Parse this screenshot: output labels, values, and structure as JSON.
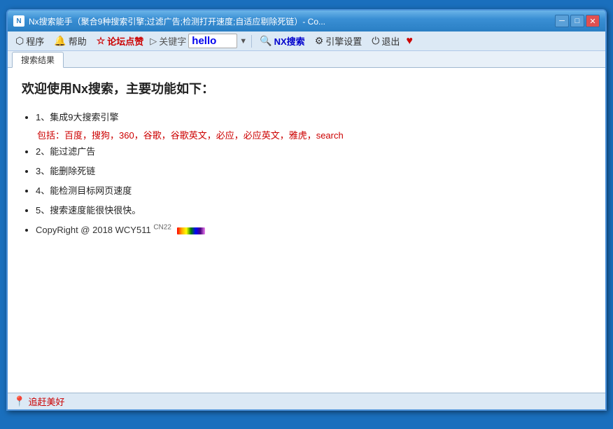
{
  "window": {
    "title": "Nx搜索能手（聚合9种搜索引擎;过滤广告;检测打开速度;自适应剔除死链）- Co...",
    "icon": "N"
  },
  "titlebar_controls": {
    "minimize": "─",
    "maximize": "□",
    "close": "✕"
  },
  "menubar": {
    "items": [
      {
        "icon": "⬡",
        "label": "程序",
        "style": "normal"
      },
      {
        "icon": "🔔",
        "label": "帮助",
        "style": "normal"
      },
      {
        "icon": "☆",
        "label": "论坛点赞",
        "style": "highlight"
      },
      {
        "icon": "▷",
        "label": "关键字",
        "style": "normal"
      },
      {
        "icon": "🔍",
        "label": "NX搜索",
        "style": "normal"
      },
      {
        "icon": "⚙",
        "label": "引擎设置",
        "style": "normal"
      },
      {
        "icon": "⏻",
        "label": "退出",
        "style": "normal"
      }
    ],
    "keyword_label": "关键字",
    "keyword_value": "hello",
    "keyword_placeholder": "hello"
  },
  "tabs": [
    {
      "label": "搜索结果",
      "active": true
    }
  ],
  "content": {
    "title": "欢迎使用Nx搜索，主要功能如下：",
    "features": [
      {
        "text": "1、集成9大搜索引擎",
        "sub": "包括：百度，搜狗，360，谷歌，谷歌英文，必应，必应英文，雅虎，search"
      },
      {
        "text": "2、能过滤广告",
        "sub": null
      },
      {
        "text": "3、能删除死链",
        "sub": null
      },
      {
        "text": "4、能检测目标网页速度",
        "sub": null
      },
      {
        "text": "5、搜索速度能很快很快。",
        "sub": null
      },
      {
        "text": "copyright_item",
        "sub": null
      }
    ],
    "copyright": "CopyRight @ 2018 WCY511",
    "copyright_suffix": "CN22"
  },
  "statusbar": {
    "text": "追赶美好",
    "icon": "📍"
  }
}
